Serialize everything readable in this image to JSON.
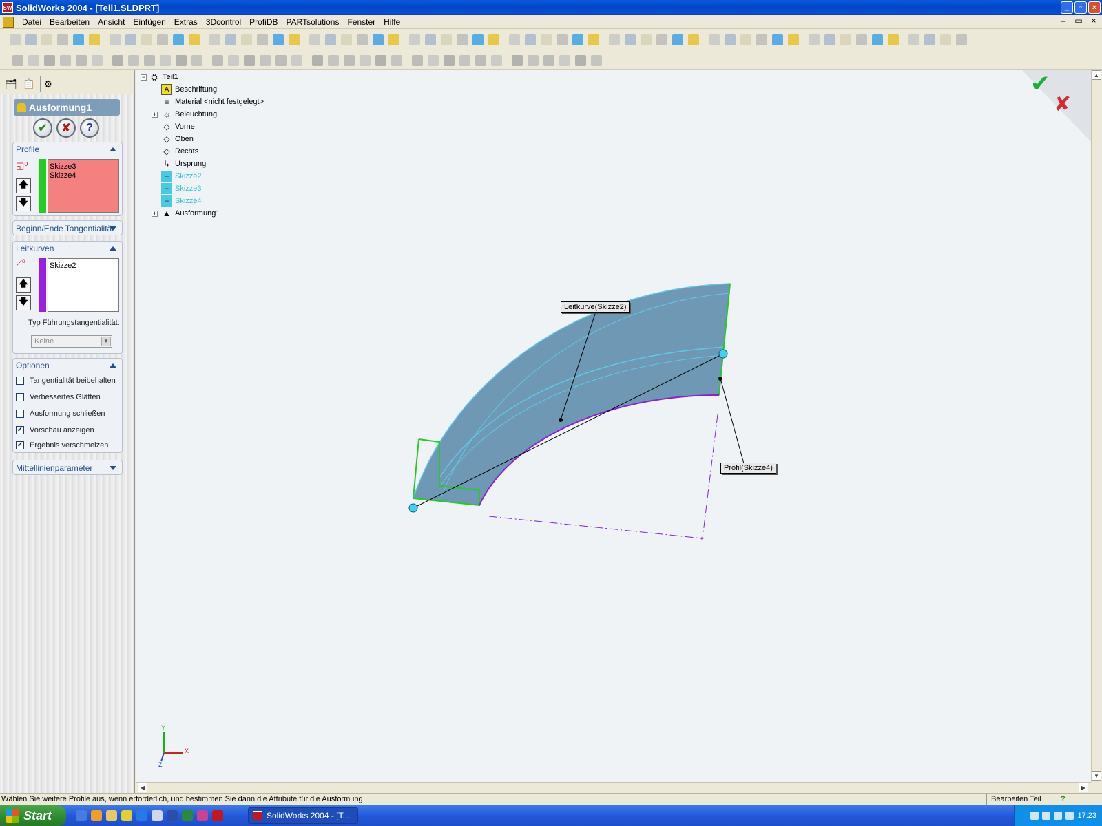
{
  "window": {
    "title": "SolidWorks 2004 - [Teil1.SLDPRT]",
    "logo_text": "SW",
    "minimize": "_",
    "maximize": "▫",
    "close": "×"
  },
  "menu": {
    "items": [
      "Datei",
      "Bearbeiten",
      "Ansicht",
      "Einfügen",
      "Extras",
      "3Dcontrol",
      "ProfiDB",
      "PARTsolutions",
      "Fenster",
      "Hilfe"
    ],
    "doc_minimize": "–",
    "doc_restore": "▭",
    "doc_close": "×"
  },
  "property_manager": {
    "title": "Ausformung1",
    "ok": "✔",
    "cancel": "✘",
    "help": "?",
    "profile": {
      "heading": "Profile",
      "items": [
        "Skizze3",
        "Skizze4"
      ]
    },
    "tangency": {
      "heading": "Beginn/Ende Tangentialität"
    },
    "guides": {
      "heading": "Leitkurven",
      "items": [
        "Skizze2"
      ],
      "type_label": "Typ Führungstangentialität:",
      "type_value": "Keine"
    },
    "options": {
      "heading": "Optionen",
      "items": [
        {
          "label": "Tangentialität beibehalten",
          "checked": false
        },
        {
          "label": "Verbessertes Glätten",
          "checked": false
        },
        {
          "label": "Ausformung schließen",
          "checked": false
        },
        {
          "label": "Vorschau anzeigen",
          "checked": true
        },
        {
          "label": "Ergebnis verschmelzen",
          "checked": true
        }
      ]
    },
    "centerline": {
      "heading": "Mittellinienparameter"
    },
    "colors": {
      "profile_bar": "#22cc22",
      "profile_bg": "#f48080",
      "guide_bar": "#9a1fe0"
    }
  },
  "tree": {
    "root": "Teil1",
    "items": [
      {
        "label": "Beschriftung",
        "icon": "annotation-icon"
      },
      {
        "label": "Material <nicht festgelegt>",
        "icon": "material-icon"
      },
      {
        "label": "Beleuchtung",
        "icon": "lighting-icon"
      },
      {
        "label": "Vorne",
        "icon": "plane-icon"
      },
      {
        "label": "Oben",
        "icon": "plane-icon"
      },
      {
        "label": "Rechts",
        "icon": "plane-icon"
      },
      {
        "label": "Ursprung",
        "icon": "origin-icon"
      },
      {
        "label": "Skizze2",
        "icon": "sketch-icon"
      },
      {
        "label": "Skizze3",
        "icon": "sketch-icon"
      },
      {
        "label": "Skizze4",
        "icon": "sketch-icon"
      },
      {
        "label": "Ausformung1",
        "icon": "loft-icon"
      }
    ]
  },
  "viewport": {
    "callout_guide": "Leitkurve(Skizze2)",
    "callout_profile": "Profil(Skizze4)",
    "axis_x": "X",
    "axis_y": "Y",
    "axis_z": "Z",
    "confirm_ok": "✔",
    "confirm_cancel": "✘",
    "colors": {
      "body": "#6f98b4",
      "edge_green": "#22cc22",
      "guide_purple": "#8a1fd8",
      "highlight": "#5fc8ea"
    }
  },
  "status": {
    "message": "Wählen Sie weitere Profile aus, wenn erforderlich, und bestimmen Sie dann die Attribute für die Ausformung",
    "mode": "Bearbeiten Teil",
    "help": "?"
  },
  "taskbar": {
    "start": "Start",
    "task": "SolidWorks 2004 - [T...",
    "clock": "17:23"
  }
}
